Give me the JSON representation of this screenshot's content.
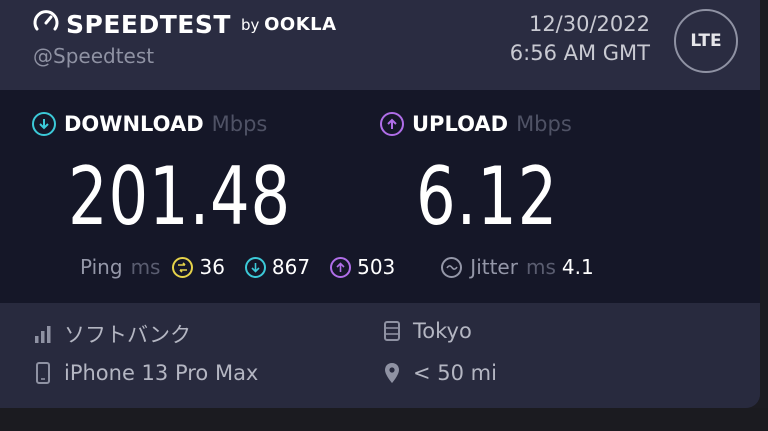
{
  "header": {
    "brand": "SPEEDTEST",
    "by": "by",
    "ookla": "OOKLA",
    "handle": "@Speedtest",
    "date": "12/30/2022",
    "time": "6:56 AM GMT",
    "network_badge": "LTE"
  },
  "download": {
    "label": "DOWNLOAD",
    "unit": "Mbps",
    "value": "201.48",
    "color": "#3cc9d8"
  },
  "upload": {
    "label": "UPLOAD",
    "unit": "Mbps",
    "value": "6.12",
    "color": "#b06ee8"
  },
  "ping": {
    "label": "Ping",
    "unit": "ms",
    "idle": "36",
    "download": "867",
    "upload": "503",
    "idle_color": "#e6d34a"
  },
  "jitter": {
    "label": "Jitter",
    "unit": "ms",
    "value": "4.1"
  },
  "details": {
    "carrier": "ソフトバンク",
    "device": "iPhone 13 Pro Max",
    "server": "Tokyo",
    "distance": "< 50 mi"
  }
}
